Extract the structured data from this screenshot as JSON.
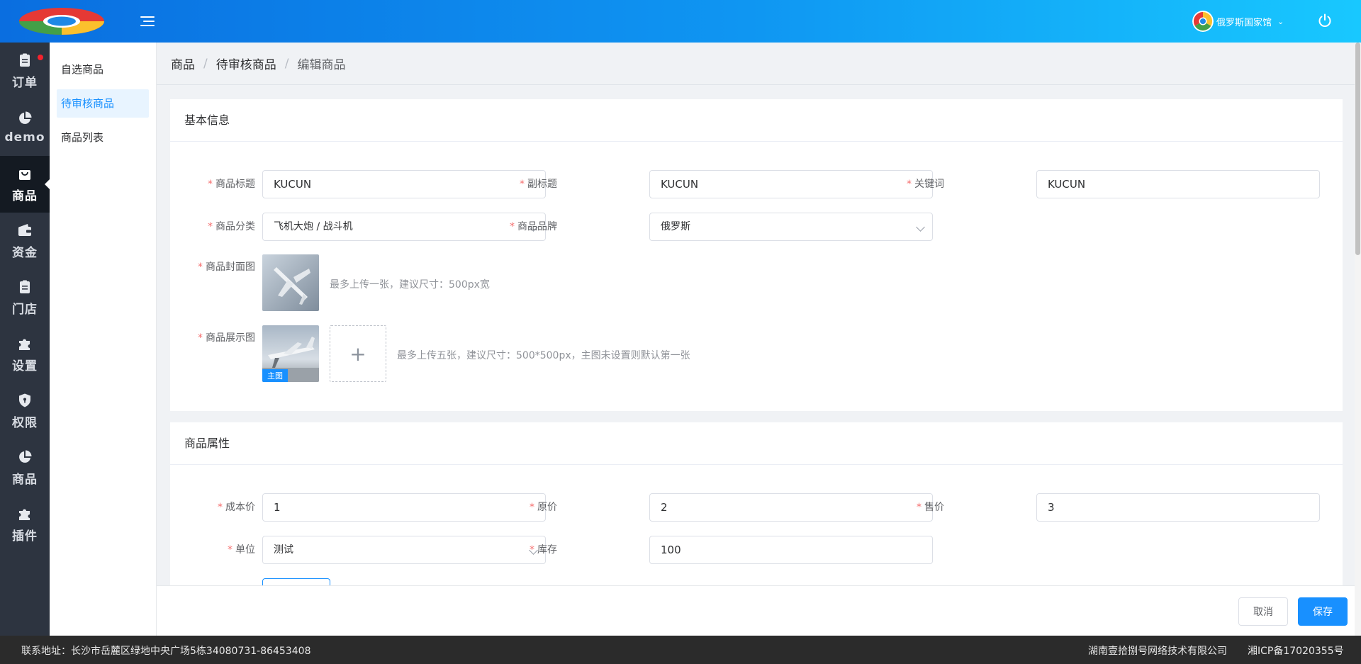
{
  "header": {
    "user_name": "俄罗斯国家馆",
    "colors": {
      "gradient_start": "#0a6ee0",
      "gradient_end": "#18c8ff"
    }
  },
  "sidebar": {
    "items": [
      {
        "label": "订单",
        "icon": "clipboard-icon"
      },
      {
        "label": "demo",
        "icon": "pie-chart-icon"
      },
      {
        "label": "商品",
        "icon": "shopping-bag-icon"
      },
      {
        "label": "资金",
        "icon": "wallet-icon"
      },
      {
        "label": "门店",
        "icon": "clipboard-icon"
      },
      {
        "label": "设置",
        "icon": "puzzle-icon"
      },
      {
        "label": "权限",
        "icon": "shield-icon"
      },
      {
        "label": "商品",
        "icon": "pie-chart-icon"
      },
      {
        "label": "插件",
        "icon": "puzzle-icon"
      }
    ],
    "active_index": 2
  },
  "submenu": {
    "items": [
      "自选商品",
      "待审核商品",
      "商品列表"
    ],
    "active_index": 1
  },
  "breadcrumb": [
    "商品",
    "待审核商品",
    "编辑商品"
  ],
  "basic_info": {
    "title": "基本信息",
    "fields": {
      "product_title": {
        "label": "商品标题",
        "value": "KUCUN"
      },
      "subtitle": {
        "label": "副标题",
        "value": "KUCUN"
      },
      "keywords": {
        "label": "关键词",
        "value": "KUCUN"
      },
      "category": {
        "label": "商品分类",
        "value": "飞机大炮 / 战斗机"
      },
      "brand": {
        "label": "商品品牌",
        "value": "俄罗斯"
      },
      "cover": {
        "label": "商品封面图",
        "hint": "最多上传一张，建议尺寸：500px宽"
      },
      "gallery": {
        "label": "商品展示图",
        "hint": "最多上传五张，建议尺寸：500*500px，主图未设置则默认第一张",
        "main_tag": "主图",
        "upload_symbol": "+"
      }
    }
  },
  "attributes": {
    "title": "商品属性",
    "fields": {
      "cost_price": {
        "label": "成本价",
        "value": "1"
      },
      "original_price": {
        "label": "原价",
        "value": "2"
      },
      "sale_price": {
        "label": "售价",
        "value": "3"
      },
      "unit": {
        "label": "单位",
        "value": "测试"
      },
      "stock": {
        "label": "库存",
        "value": "100"
      }
    }
  },
  "actions": {
    "cancel": "取消",
    "save": "保存"
  },
  "footer": {
    "address": "联系地址：长沙市岳麓区绿地中央广场5栋34080731-86453408",
    "company": "湖南壹拾捌号网络技术有限公司",
    "icp": "湘ICP备17020355号"
  }
}
